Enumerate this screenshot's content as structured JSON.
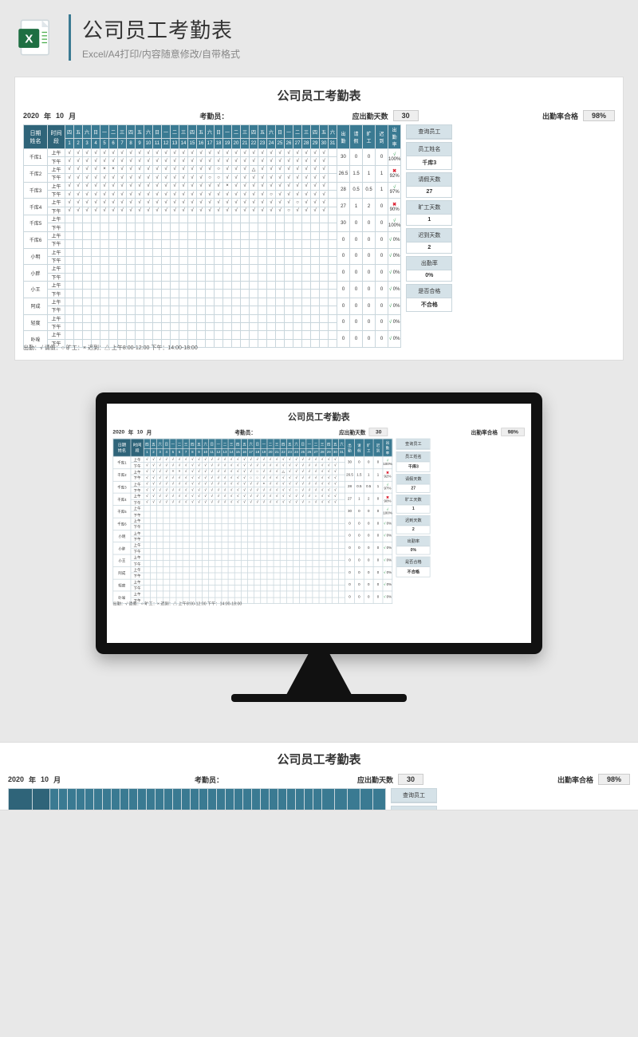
{
  "page": {
    "title": "公司员工考勤表",
    "subtitle": "Excel/A4打印/内容随意修改/自带格式"
  },
  "sheet": {
    "title": "公司员工考勤表",
    "year": "2020",
    "year_label": "年",
    "month": "10",
    "month_label": "月",
    "recorder_label": "考勤员：",
    "due_days_label": "应出勤天数",
    "due_days_value": "30",
    "pass_rate_label": "出勤率合格",
    "pass_rate_value": "98%",
    "corner_date": "日期",
    "corner_name": "姓名",
    "shift_header": "时间段",
    "shifts": [
      "上午",
      "下午"
    ],
    "weekdays": [
      "四",
      "五",
      "六",
      "日",
      "一",
      "二",
      "三",
      "四",
      "五",
      "六",
      "日",
      "一",
      "二",
      "三",
      "四",
      "五",
      "六",
      "日",
      "一",
      "二",
      "三",
      "四",
      "五",
      "六",
      "日",
      "一",
      "二",
      "三",
      "四",
      "五",
      "六"
    ],
    "days": [
      "1",
      "2",
      "3",
      "4",
      "5",
      "6",
      "7",
      "8",
      "9",
      "10",
      "11",
      "12",
      "13",
      "14",
      "15",
      "16",
      "17",
      "18",
      "19",
      "20",
      "21",
      "22",
      "23",
      "24",
      "25",
      "26",
      "27",
      "28",
      "29",
      "30",
      "31"
    ],
    "summary_headers": [
      "出勤",
      "请假",
      "旷工",
      "迟到",
      "出勤率"
    ],
    "legend": "出勤：√ 请假：○ 旷工：× 迟到：△   上午8:00-12:00   下午：14:00-18:00"
  },
  "employees": [
    {
      "name": "千库1",
      "summary": [
        "30",
        "0",
        "0",
        "0",
        "100%"
      ],
      "pass": true,
      "am": [
        "√",
        "√",
        "√",
        "√",
        "√",
        "√",
        "√",
        "√",
        "√",
        "√",
        "√",
        "√",
        "√",
        "√",
        "√",
        "√",
        "√",
        "√",
        "√",
        "√",
        "√",
        "√",
        "√",
        "√",
        "√",
        "√",
        "√",
        "√",
        "√",
        "√",
        ""
      ],
      "pm": [
        "√",
        "√",
        "√",
        "√",
        "√",
        "√",
        "√",
        "√",
        "√",
        "√",
        "√",
        "√",
        "√",
        "√",
        "√",
        "√",
        "√",
        "√",
        "√",
        "√",
        "√",
        "√",
        "√",
        "√",
        "√",
        "√",
        "√",
        "√",
        "√",
        "√",
        ""
      ]
    },
    {
      "name": "千库2",
      "summary": [
        "26.5",
        "1.5",
        "1",
        "1",
        "92%"
      ],
      "pass": false,
      "am": [
        "√",
        "√",
        "√",
        "√",
        "×",
        "×",
        "√",
        "√",
        "√",
        "√",
        "√",
        "√",
        "√",
        "√",
        "√",
        "√",
        "√",
        "○",
        "√",
        "√",
        "√",
        "△",
        "√",
        "√",
        "√",
        "√",
        "√",
        "√",
        "√",
        "√",
        ""
      ],
      "pm": [
        "√",
        "√",
        "√",
        "√",
        "√",
        "√",
        "√",
        "√",
        "√",
        "√",
        "√",
        "√",
        "√",
        "√",
        "√",
        "√",
        "○",
        "○",
        "√",
        "√",
        "√",
        "√",
        "√",
        "√",
        "√",
        "√",
        "√",
        "√",
        "√",
        "√",
        ""
      ]
    },
    {
      "name": "千库3",
      "summary": [
        "28",
        "0.5",
        "0.5",
        "1",
        "97%"
      ],
      "pass": true,
      "am": [
        "√",
        "√",
        "√",
        "√",
        "√",
        "√",
        "√",
        "√",
        "√",
        "√",
        "√",
        "√",
        "√",
        "√",
        "√",
        "√",
        "√",
        "√",
        "×",
        "√",
        "√",
        "√",
        "√",
        "√",
        "√",
        "√",
        "√",
        "√",
        "√",
        "√",
        ""
      ],
      "pm": [
        "√",
        "√",
        "√",
        "√",
        "√",
        "√",
        "√",
        "√",
        "√",
        "√",
        "√",
        "√",
        "√",
        "√",
        "√",
        "√",
        "√",
        "√",
        "√",
        "√",
        "√",
        "√",
        "√",
        "○",
        "√",
        "√",
        "√",
        "√",
        "√",
        "√",
        ""
      ]
    },
    {
      "name": "千库4",
      "summary": [
        "27",
        "1",
        "2",
        "0",
        "90%"
      ],
      "pass": false,
      "am": [
        "√",
        "√",
        "√",
        "√",
        "√",
        "√",
        "√",
        "√",
        "√",
        "√",
        "√",
        "√",
        "√",
        "√",
        "√",
        "√",
        "√",
        "√",
        "√",
        "√",
        "√",
        "√",
        "√",
        "√",
        "√",
        "√",
        "○",
        "√",
        "√",
        "√",
        ""
      ],
      "pm": [
        "√",
        "√",
        "√",
        "√",
        "√",
        "√",
        "√",
        "√",
        "√",
        "√",
        "√",
        "√",
        "√",
        "√",
        "√",
        "√",
        "√",
        "√",
        "√",
        "√",
        "√",
        "√",
        "√",
        "√",
        "√",
        "○",
        "√",
        "√",
        "√",
        "√",
        ""
      ]
    },
    {
      "name": "千库5",
      "summary": [
        "30",
        "0",
        "0",
        "0",
        "100%"
      ],
      "pass": true,
      "am": [
        "",
        "",
        "",
        "",
        "",
        "",
        "",
        "",
        "",
        "",
        "",
        "",
        "",
        "",
        "",
        "",
        "",
        "",
        "",
        "",
        "",
        "",
        "",
        "",
        "",
        "",
        "",
        "",
        "",
        "",
        ""
      ],
      "pm": [
        "",
        "",
        "",
        "",
        "",
        "",
        "",
        "",
        "",
        "",
        "",
        "",
        "",
        "",
        "",
        "",
        "",
        "",
        "",
        "",
        "",
        "",
        "",
        "",
        "",
        "",
        "",
        "",
        "",
        "",
        ""
      ]
    },
    {
      "name": "千库6",
      "summary": [
        "0",
        "0",
        "0",
        "0",
        "0%"
      ],
      "pass": true,
      "am": [
        "",
        "",
        "",
        "",
        "",
        "",
        "",
        "",
        "",
        "",
        "",
        "",
        "",
        "",
        "",
        "",
        "",
        "",
        "",
        "",
        "",
        "",
        "",
        "",
        "",
        "",
        "",
        "",
        "",
        "",
        ""
      ],
      "pm": [
        "",
        "",
        "",
        "",
        "",
        "",
        "",
        "",
        "",
        "",
        "",
        "",
        "",
        "",
        "",
        "",
        "",
        "",
        "",
        "",
        "",
        "",
        "",
        "",
        "",
        "",
        "",
        "",
        "",
        "",
        ""
      ]
    },
    {
      "name": "小明",
      "summary": [
        "0",
        "0",
        "0",
        "0",
        "0%"
      ],
      "pass": true,
      "am": [
        "",
        "",
        "",
        "",
        "",
        "",
        "",
        "",
        "",
        "",
        "",
        "",
        "",
        "",
        "",
        "",
        "",
        "",
        "",
        "",
        "",
        "",
        "",
        "",
        "",
        "",
        "",
        "",
        "",
        "",
        ""
      ],
      "pm": [
        "",
        "",
        "",
        "",
        "",
        "",
        "",
        "",
        "",
        "",
        "",
        "",
        "",
        "",
        "",
        "",
        "",
        "",
        "",
        "",
        "",
        "",
        "",
        "",
        "",
        "",
        "",
        "",
        "",
        "",
        ""
      ]
    },
    {
      "name": "小胖",
      "summary": [
        "0",
        "0",
        "0",
        "0",
        "0%"
      ],
      "pass": true,
      "am": [
        "",
        "",
        "",
        "",
        "",
        "",
        "",
        "",
        "",
        "",
        "",
        "",
        "",
        "",
        "",
        "",
        "",
        "",
        "",
        "",
        "",
        "",
        "",
        "",
        "",
        "",
        "",
        "",
        "",
        "",
        ""
      ],
      "pm": [
        "",
        "",
        "",
        "",
        "",
        "",
        "",
        "",
        "",
        "",
        "",
        "",
        "",
        "",
        "",
        "",
        "",
        "",
        "",
        "",
        "",
        "",
        "",
        "",
        "",
        "",
        "",
        "",
        "",
        "",
        ""
      ]
    },
    {
      "name": "小王",
      "summary": [
        "0",
        "0",
        "0",
        "0",
        "0%"
      ],
      "pass": true,
      "am": [
        "",
        "",
        "",
        "",
        "",
        "",
        "",
        "",
        "",
        "",
        "",
        "",
        "",
        "",
        "",
        "",
        "",
        "",
        "",
        "",
        "",
        "",
        "",
        "",
        "",
        "",
        "",
        "",
        "",
        "",
        ""
      ],
      "pm": [
        "",
        "",
        "",
        "",
        "",
        "",
        "",
        "",
        "",
        "",
        "",
        "",
        "",
        "",
        "",
        "",
        "",
        "",
        "",
        "",
        "",
        "",
        "",
        "",
        "",
        "",
        "",
        "",
        "",
        "",
        ""
      ]
    },
    {
      "name": "阿成",
      "summary": [
        "0",
        "0",
        "0",
        "0",
        "0%"
      ],
      "pass": true,
      "am": [
        "",
        "",
        "",
        "",
        "",
        "",
        "",
        "",
        "",
        "",
        "",
        "",
        "",
        "",
        "",
        "",
        "",
        "",
        "",
        "",
        "",
        "",
        "",
        "",
        "",
        "",
        "",
        "",
        "",
        "",
        ""
      ],
      "pm": [
        "",
        "",
        "",
        "",
        "",
        "",
        "",
        "",
        "",
        "",
        "",
        "",
        "",
        "",
        "",
        "",
        "",
        "",
        "",
        "",
        "",
        "",
        "",
        "",
        "",
        "",
        "",
        "",
        "",
        "",
        ""
      ]
    },
    {
      "name": "轻度",
      "summary": [
        "0",
        "0",
        "0",
        "0",
        "0%"
      ],
      "pass": true,
      "am": [
        "",
        "",
        "",
        "",
        "",
        "",
        "",
        "",
        "",
        "",
        "",
        "",
        "",
        "",
        "",
        "",
        "",
        "",
        "",
        "",
        "",
        "",
        "",
        "",
        "",
        "",
        "",
        "",
        "",
        "",
        ""
      ],
      "pm": [
        "",
        "",
        "",
        "",
        "",
        "",
        "",
        "",
        "",
        "",
        "",
        "",
        "",
        "",
        "",
        "",
        "",
        "",
        "",
        "",
        "",
        "",
        "",
        "",
        "",
        "",
        "",
        "",
        "",
        "",
        ""
      ]
    },
    {
      "name": "卟哚",
      "summary": [
        "0",
        "0",
        "0",
        "0",
        "0%"
      ],
      "pass": true,
      "am": [
        "",
        "",
        "",
        "",
        "",
        "",
        "",
        "",
        "",
        "",
        "",
        "",
        "",
        "",
        "",
        "",
        "",
        "",
        "",
        "",
        "",
        "",
        "",
        "",
        "",
        "",
        "",
        "",
        "",
        "",
        ""
      ],
      "pm": [
        "",
        "",
        "",
        "",
        "",
        "",
        "",
        "",
        "",
        "",
        "",
        "",
        "",
        "",
        "",
        "",
        "",
        "",
        "",
        "",
        "",
        "",
        "",
        "",
        "",
        "",
        "",
        "",
        "",
        "",
        ""
      ]
    }
  ],
  "sidebar": {
    "header": "查询员工",
    "rows": [
      {
        "label": "员工姓名",
        "value": "千库3"
      },
      {
        "label": "请假天数",
        "value": "27"
      },
      {
        "label": "旷工天数",
        "value": "1"
      },
      {
        "label": "迟到天数",
        "value": "2"
      },
      {
        "label": "出勤率",
        "value": "0%"
      },
      {
        "label": "是否合格",
        "value": "不合格"
      }
    ]
  }
}
